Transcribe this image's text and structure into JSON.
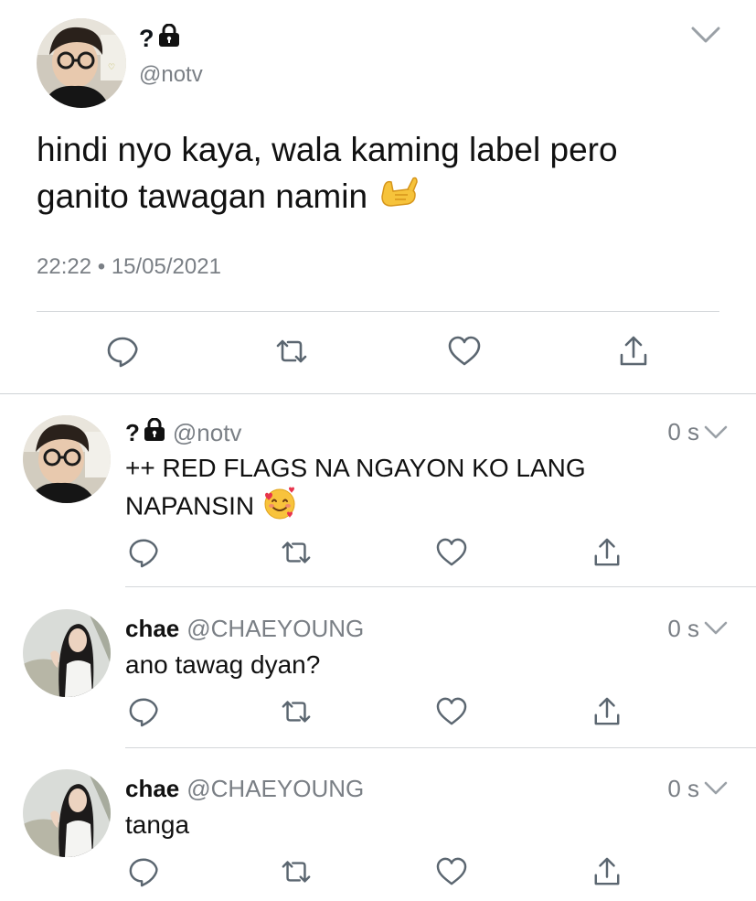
{
  "main_tweet": {
    "display_name": "?",
    "handle": "@notv",
    "text_line1": "hindi nyo kaya, wala kaming label pero",
    "text_line2": "ganito tawagan namin",
    "time": "22:22",
    "separator": "•",
    "date": "15/05/2021"
  },
  "replies": [
    {
      "display_name": "?",
      "handle": "@notv",
      "time": "0 s",
      "text_line1": "++ RED FLAGS NA NGAYON KO LANG",
      "text_line2": "NAPANSIN"
    },
    {
      "display_name": "chae",
      "handle": "@CHAEYOUNG",
      "time": "0 s",
      "text_line1": "ano tawag dyan?"
    },
    {
      "display_name": "chae",
      "handle": "@CHAEYOUNG",
      "time": "0 s",
      "text_line1": "tanga"
    }
  ],
  "icons": {
    "reply": "reply-icon",
    "retweet": "retweet-icon",
    "like": "like-icon",
    "share": "share-icon",
    "lock": "lock-icon",
    "chevron": "chevron-down-icon",
    "call_me_hand": "call-me-hand-emoji",
    "smiling_hearts": "smiling-face-with-hearts-emoji"
  },
  "colors": {
    "text": "#111111",
    "secondary": "#7a7f85",
    "icon": "#5b6670",
    "divider": "#d4d7da"
  }
}
